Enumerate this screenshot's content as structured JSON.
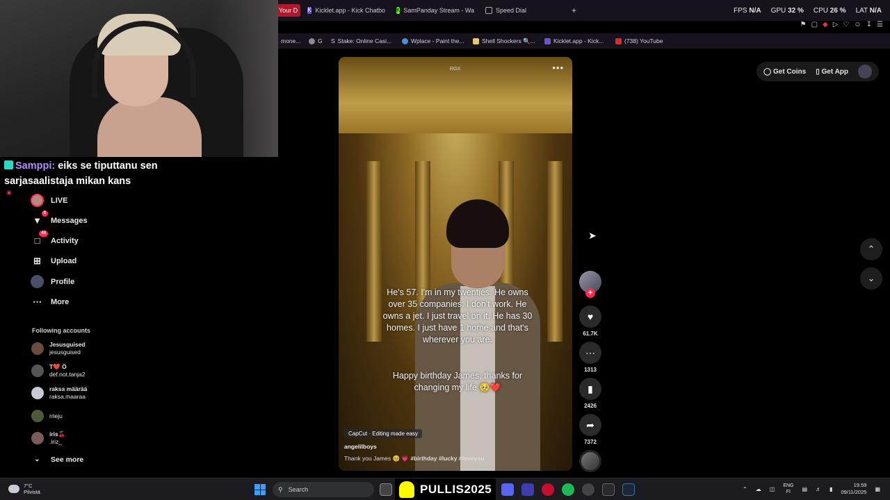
{
  "browser": {
    "tabs": [
      {
        "label": "Your D",
        "active": true
      },
      {
        "label": "Kicklet.app - Kick Chatbo"
      },
      {
        "label": "SamPanday Stream - Wa"
      },
      {
        "label": "Speed Dial"
      }
    ],
    "new_tab": "+",
    "stats": {
      "fps_label": "FPS",
      "fps_value": "N/A",
      "gpu_label": "GPU",
      "gpu_value": "32 %",
      "cpu_label": "CPU",
      "cpu_value": "26 %",
      "lat_label": "LAT",
      "lat_value": "N/A"
    },
    "bookmarks": [
      {
        "label": "mone..."
      },
      {
        "label": "G"
      },
      {
        "label": "Stake: Online Casi..."
      },
      {
        "label": "Wplace - Paint the..."
      },
      {
        "label": "Shell Shockers 🔍..."
      },
      {
        "label": "Kicklet.app - Kick..."
      },
      {
        "label": "(738) YouTube"
      }
    ]
  },
  "chat": {
    "user": "Samppi:",
    "message": "eiks se tiputtanu sen sarjasaalistaja mikan kans"
  },
  "sidebar": {
    "nav": [
      {
        "label": "LIVE"
      },
      {
        "label": "Messages",
        "badge": "8"
      },
      {
        "label": "Activity",
        "badge": "48"
      },
      {
        "label": "Upload"
      },
      {
        "label": "Profile"
      },
      {
        "label": "More"
      }
    ],
    "following_title": "Following accounts",
    "accounts": [
      {
        "name": "Jesusguised",
        "handle": "jesusguised"
      },
      {
        "name": "T❤️ Ö",
        "handle": "def.not.tanja2"
      },
      {
        "name": "raksa määrää",
        "handle": "raksa.maaraa"
      },
      {
        "name": "",
        "handle": "rrieju"
      },
      {
        "name": "iris🍒",
        "handle": ".iriz_"
      }
    ],
    "see_more": "See more"
  },
  "video": {
    "logo": "RGX",
    "more": "•••",
    "caption_1": "He's 57. I'm in my twenties. He owns over 35 companies. I don't work. He owns a jet. I just travel on it. He has 30 homes. I just have 1 home and that's wherever you are.",
    "caption_2": "Happy birthday James, thanks for changing my life 🥹❤️",
    "capcut": "CapCut · Editing made easy",
    "username": "angelilboys",
    "description": "Thank you James 🥹 💗",
    "tags": [
      "#birthday",
      "#lucky",
      "#loveyou"
    ]
  },
  "actions": {
    "likes": "61.7K",
    "comments": "1313",
    "saves": "2426",
    "shares": "7372"
  },
  "header": {
    "get_coins": "Get Coins",
    "get_app": "Get App"
  },
  "taskbar": {
    "temp": "7°C",
    "weather": "Pilvistä",
    "search": "Search",
    "promo": "PULLIS2025",
    "lang_1": "ENG",
    "lang_2": "FI",
    "time": "19.59",
    "date": "09/11/2025"
  },
  "colors": {
    "accent": "#fe2c55",
    "tab_active": "#b0182b",
    "chrome": "#17121c"
  }
}
